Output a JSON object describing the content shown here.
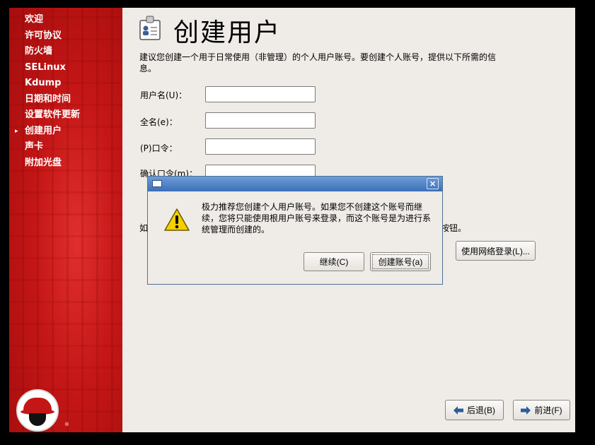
{
  "sidebar": {
    "items": [
      {
        "label": "欢迎"
      },
      {
        "label": "许可协议"
      },
      {
        "label": "防火墙"
      },
      {
        "label": "SELinux"
      },
      {
        "label": "Kdump"
      },
      {
        "label": "日期和时间"
      },
      {
        "label": "设置软件更新"
      },
      {
        "label": "创建用户",
        "active": true
      },
      {
        "label": "声卡"
      },
      {
        "label": "附加光盘"
      }
    ],
    "logo_mark": "®"
  },
  "main": {
    "title": "创建用户",
    "intro": "建议您创建一个用于日常使用（非管理）的个人用户账号。要创建个人账号，提供以下所需的信息。",
    "fields": {
      "username_label": "用户名(U)：",
      "fullname_label": "全名(e)：",
      "password_label": "(P)口令：",
      "confirm_label": "确认口令(m)："
    },
    "obscured_text_start": "如",
    "obscured_text_end": "按钮。",
    "network_login_button": "使用网络登录(L)..."
  },
  "navigation": {
    "back_label": "后退(B)",
    "forward_label": "前进(F)"
  },
  "dialog": {
    "message": "极力推荐您创建个人用户账号。如果您不创建这个账号而继续，您将只能使用根用户账号来登录，而这个账号是为进行系统管理而创建的。",
    "continue_label": "继续(C)",
    "create_label": "创建账号(a)",
    "close_symbol": "×"
  },
  "colors": {
    "sidebar_red": "#c41616",
    "titlebar_blue": "#3d6fb8",
    "background": "#efebe7"
  }
}
